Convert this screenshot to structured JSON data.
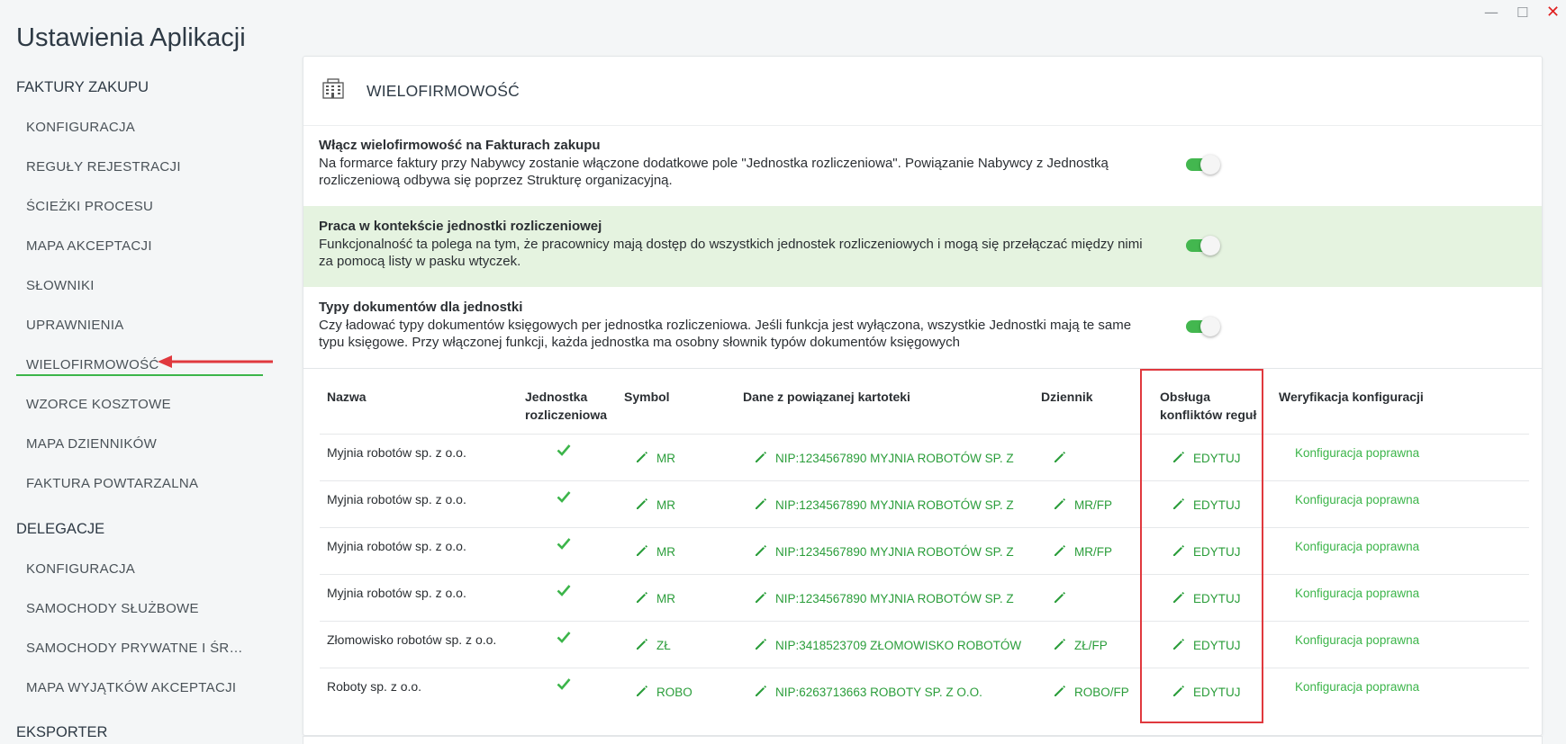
{
  "window": {
    "minimize": "—",
    "maximize": "☐",
    "close": "✕"
  },
  "app_title": "Ustawienia Aplikacji",
  "sidebar": {
    "sections": [
      {
        "label": "FAKTURY ZAKUPU",
        "items": [
          "KONFIGURACJA",
          "REGUŁY REJESTRACJI",
          "ŚCIEŻKI PROCESU",
          "MAPA AKCEPTACJI",
          "SŁOWNIKI",
          "UPRAWNIENIA",
          "WIELOFIRMOWOŚĆ",
          "WZORCE KOSZTOWE",
          "MAPA DZIENNIKÓW",
          "FAKTURA POWTARZALNA"
        ]
      },
      {
        "label": "DELEGACJE",
        "items": [
          "KONFIGURACJA",
          "SAMOCHODY SŁUŻBOWE",
          "SAMOCHODY PRYWATNE I ŚROD…",
          "MAPA WYJĄTKÓW AKCEPTACJI"
        ]
      },
      {
        "label": "EKSPORTER",
        "items": []
      }
    ],
    "active_item": "WIELOFIRMOWOŚĆ"
  },
  "panel": {
    "icon": "building-icon",
    "title": "WIELOFIRMOWOŚĆ",
    "options": [
      {
        "title": "Włącz wielofirmowość na Fakturach zakupu",
        "desc1": "Na formarce faktury przy Nabywcy zostanie włączone dodatkowe pole \"Jednostka rozliczeniowa\". Powiązanie Nabywcy z Jednostką",
        "desc2": "rozliczeniową odbywa się poprzez Strukturę organizacyjną.",
        "enabled": true,
        "highlighted": false
      },
      {
        "title": "Praca w kontekście jednostki rozliczeniowej",
        "desc1": "Funkcjonalność ta polega na tym, że pracownicy mają dostęp do wszystkich jednostek rozliczeniowych i mogą się przełączać między nimi",
        "desc2": "za pomocą listy w pasku wtyczek.",
        "enabled": true,
        "highlighted": true
      },
      {
        "title": "Typy dokumentów dla jednostki",
        "desc1": "Czy ładować typy dokumentów księgowych per jednostka rozliczeniowa. Jeśli funkcja jest wyłączona, wszystkie Jednostki mają te same",
        "desc2": "typu księgowe. Przy włączonej funkcji, każda jednostka ma osobny słownik typów dokumentów księgowych",
        "enabled": true,
        "highlighted": false
      }
    ],
    "table": {
      "headers": {
        "nazwa": "Nazwa",
        "jednostka_1": "Jednostka",
        "jednostka_2": "rozliczeniowa",
        "symbol": "Symbol",
        "dane": "Dane z powiązanej kartoteki",
        "dziennik": "Dziennik",
        "obsluga_1": "Obsługa",
        "obsluga_2": "konfliktów reguł",
        "weryfikacja": "Weryfikacja konfiguracji"
      },
      "rows": [
        {
          "name": "Myjnia robotów sp. z o.o.",
          "unit": true,
          "symbol": "MR",
          "data": "NIP:1234567890 MYJNIA ROBOTÓW SP. Z",
          "journal": "",
          "conflicts": "EDYTUJ",
          "verification": "Konfiguracja poprawna"
        },
        {
          "name": "Myjnia robotów sp. z o.o.",
          "unit": true,
          "symbol": "MR",
          "data": "NIP:1234567890 MYJNIA ROBOTÓW SP. Z",
          "journal": "MR/FP",
          "conflicts": "EDYTUJ",
          "verification": "Konfiguracja poprawna"
        },
        {
          "name": "Myjnia robotów sp. z o.o.",
          "unit": true,
          "symbol": "MR",
          "data": "NIP:1234567890 MYJNIA ROBOTÓW SP. Z",
          "journal": "MR/FP",
          "conflicts": "EDYTUJ",
          "verification": "Konfiguracja poprawna"
        },
        {
          "name": "Myjnia robotów sp. z o.o.",
          "unit": true,
          "symbol": "MR",
          "data": "NIP:1234567890 MYJNIA ROBOTÓW SP. Z",
          "journal": "",
          "conflicts": "EDYTUJ",
          "verification": "Konfiguracja poprawna"
        },
        {
          "name": "Złomowisko robotów sp. z o.o.",
          "unit": true,
          "symbol": "ZŁ",
          "data": "NIP:3418523709 ZŁOMOWISKO ROBOTÓW",
          "journal": "ZŁ/FP",
          "conflicts": "EDYTUJ",
          "verification": "Konfiguracja poprawna"
        },
        {
          "name": "Roboty sp. z o.o.",
          "unit": true,
          "symbol": "ROBO",
          "data": "NIP:6263713663 ROBOTY SP. Z O.O.",
          "journal": "ROBO/FP",
          "conflicts": "EDYTUJ",
          "verification": "Konfiguracja poprawna"
        }
      ]
    }
  },
  "colors": {
    "accent": "#3cb54a",
    "link": "#2a9d3a",
    "highlight_row": "#e5f3e0",
    "annotation": "#e0393e"
  }
}
